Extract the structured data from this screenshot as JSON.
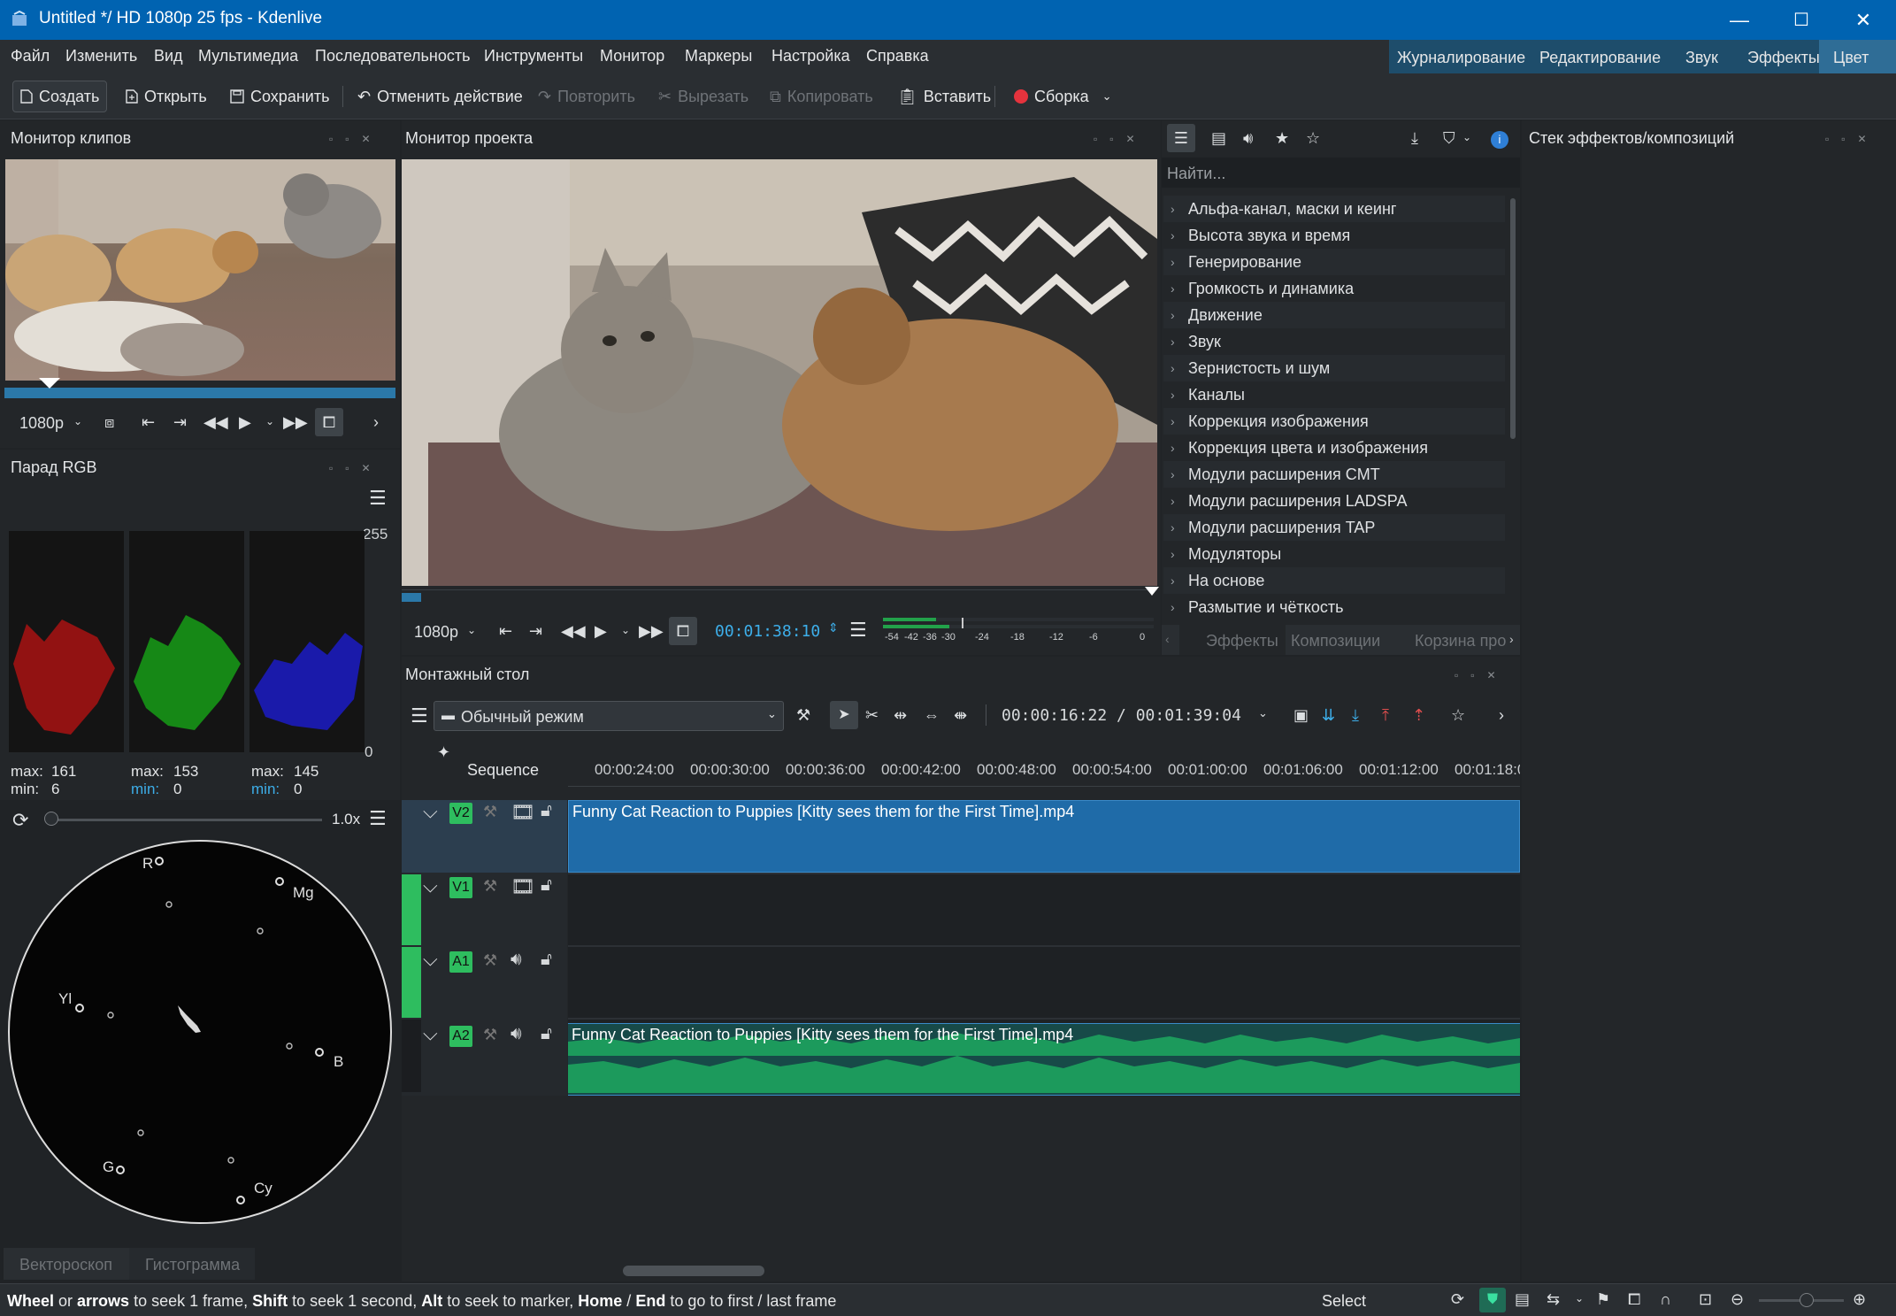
{
  "window": {
    "title": "Untitled */ HD 1080p 25 fps - Kdenlive",
    "controls": {
      "minimize": "—",
      "maximize": "☐",
      "close": "✕"
    }
  },
  "menu": {
    "items": [
      "Файл",
      "Изменить",
      "Вид",
      "Мультимедиа",
      "Последовательность",
      "Инструменты",
      "Монитор",
      "Маркеры",
      "Настройка",
      "Справка"
    ],
    "layouts": [
      "Журналирование",
      "Редактирование",
      "Звук",
      "Эффекты",
      "Цвет"
    ]
  },
  "toolbar": {
    "new": "Создать",
    "open": "Открыть",
    "save": "Сохранить",
    "undo": "Отменить действие",
    "redo": "Повторить",
    "cut": "Вырезать",
    "copy": "Копировать",
    "paste": "Вставить",
    "render": "Сборка"
  },
  "clip_monitor": {
    "title": "Монитор клипов",
    "resolution": "1080p"
  },
  "project_monitor": {
    "title": "Монитор проекта",
    "resolution": "1080p",
    "timecode": "00:01:38:10",
    "audio_meter_labels": [
      "-54",
      "-42",
      "-36",
      "-30",
      "-24",
      "-18",
      "-12",
      "-6",
      "0"
    ]
  },
  "rgb_parade": {
    "title": "Парад RGB",
    "top_value": "255",
    "bottom_value": "0",
    "channels": [
      {
        "max_label": "max:",
        "max": "161",
        "min_label": "min:",
        "min": "6"
      },
      {
        "max_label": "max:",
        "max": "153",
        "min_label": "min:",
        "min": "0"
      },
      {
        "max_label": "max:",
        "max": "145",
        "min_label": "min:",
        "min": "0"
      }
    ]
  },
  "vectorscope": {
    "zoom": "1.0x",
    "labels": [
      "R",
      "Mg",
      "Yl",
      "B",
      "G",
      "Cy"
    ],
    "tabs": [
      "Вектороскоп",
      "Гистограмма"
    ]
  },
  "effects": {
    "search_placeholder": "Найти...",
    "categories": [
      "Альфа-канал, маски и кеинг",
      "Высота звука и время",
      "Генерирование",
      "Громкость и динамика",
      "Движение",
      "Звук",
      "Зернистость и шум",
      "Каналы",
      "Коррекция изображения",
      "Коррекция цвета и изображения",
      "Модули расширения CMT",
      "Модули расширения LADSPA",
      "Модули расширения TAP",
      "Модуляторы",
      "На основе",
      "Размытие и чёткость"
    ],
    "tabs": [
      "Эффекты",
      "Композиции",
      "Корзина про"
    ]
  },
  "effect_stack": {
    "title": "Стек эффектов/композиций"
  },
  "timeline": {
    "title": "Монтажный стол",
    "mode": "Обычный режим",
    "position": "00:00:16:22 / 00:01:39:04",
    "sequence": "Sequence",
    "ruler": [
      "00:00:24:00",
      "00:00:30:00",
      "00:00:36:00",
      "00:00:42:00",
      "00:00:48:00",
      "00:00:54:00",
      "00:01:00:00",
      "00:01:06:00",
      "00:01:12:00",
      "00:01:18:0"
    ],
    "tracks": [
      {
        "name": "V2",
        "clip": "Funny Cat Reaction to Puppies [Kitty sees them for the First Time].mp4"
      },
      {
        "name": "V1",
        "clip": ""
      },
      {
        "name": "A1",
        "clip": ""
      },
      {
        "name": "A2",
        "clip": "Funny Cat Reaction to Puppies [Kitty sees them for the First Time].mp4"
      }
    ]
  },
  "statusbar": {
    "hint_parts": [
      "Wheel",
      " or ",
      "arrows",
      " to seek 1 frame, ",
      "Shift",
      " to seek 1 second, ",
      "Alt",
      " to seek to marker, ",
      "Home",
      " / ",
      "End",
      " to go to first / last frame"
    ],
    "tool": "Select"
  }
}
